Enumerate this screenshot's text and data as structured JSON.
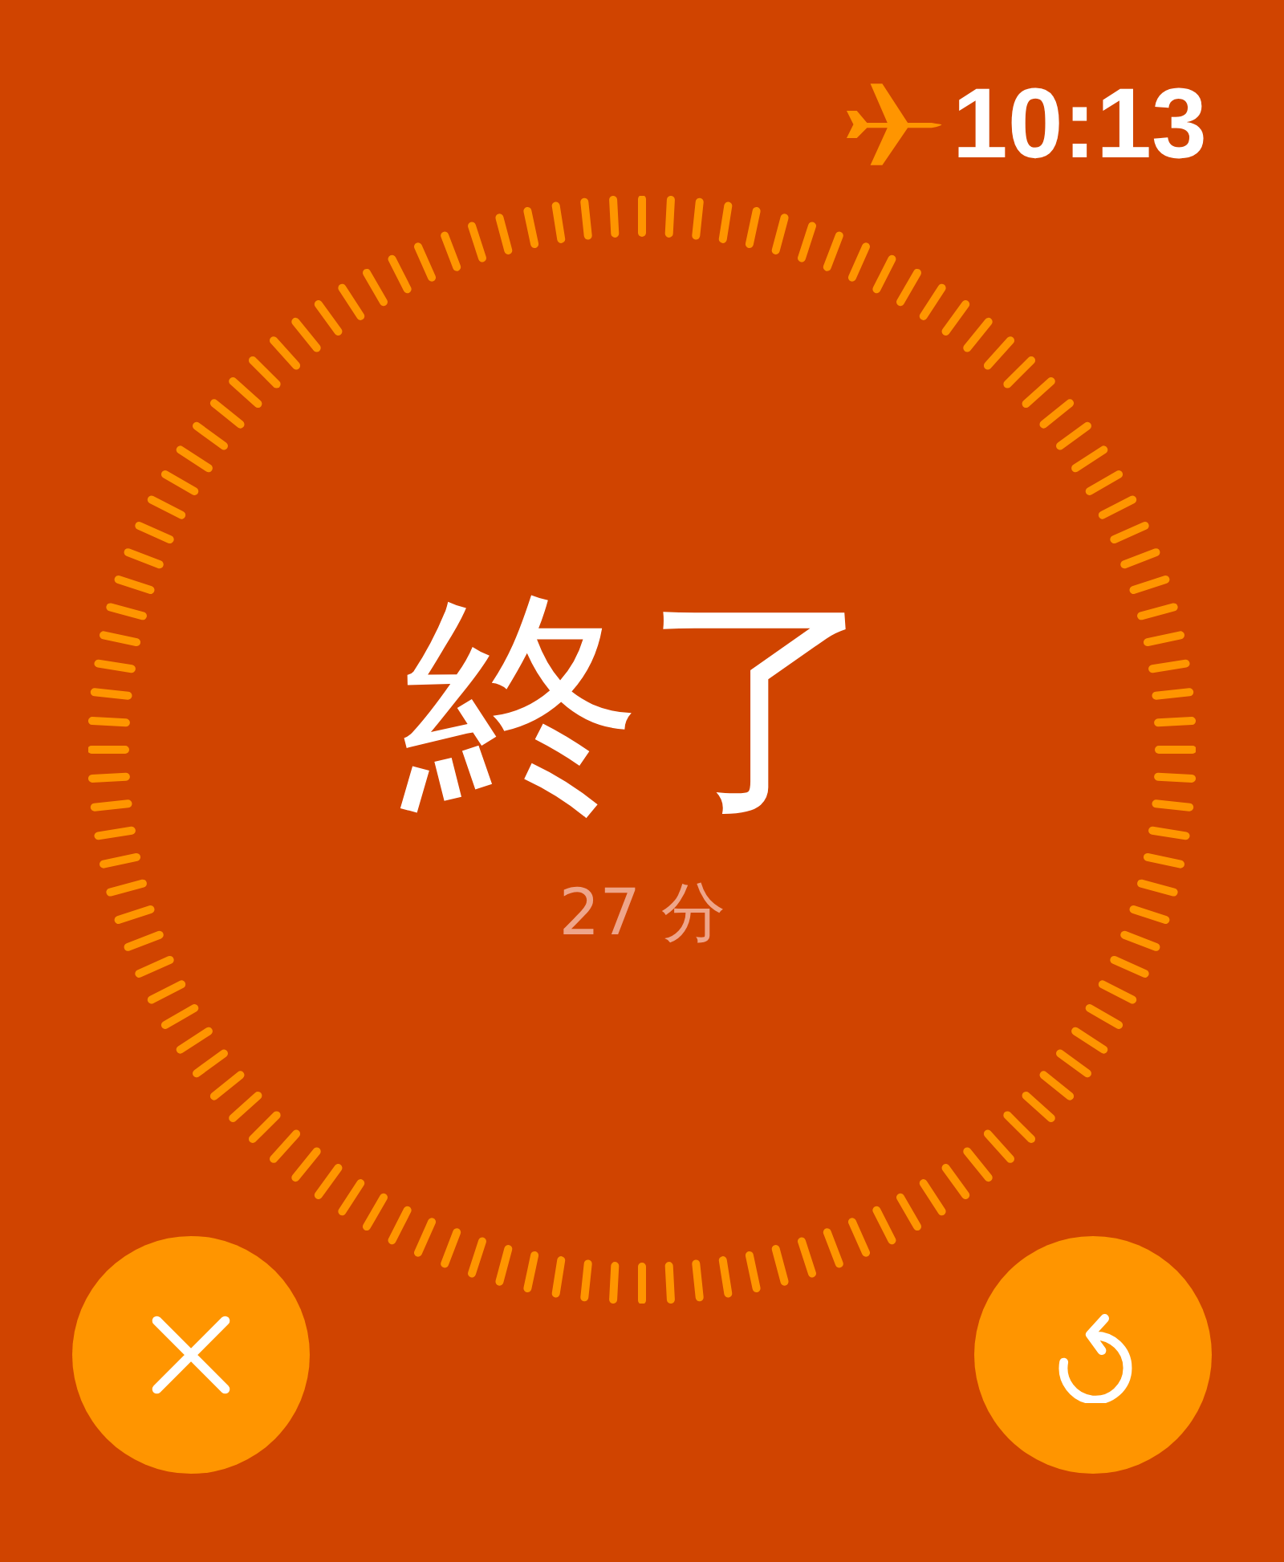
{
  "status_bar": {
    "airplane_mode": true,
    "time": "10:13"
  },
  "timer": {
    "title": "終了",
    "duration": "27 分"
  },
  "buttons": [
    {
      "kind": "cancel"
    },
    {
      "kind": "repeat"
    }
  ]
}
